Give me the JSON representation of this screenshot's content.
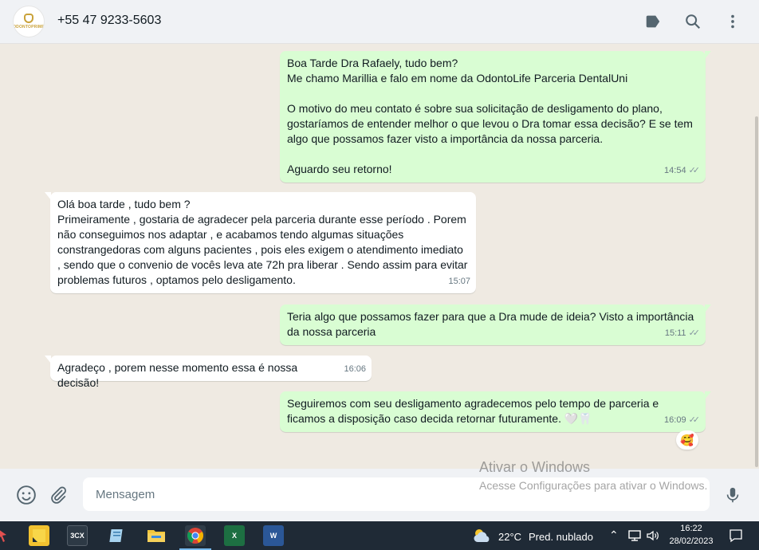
{
  "header": {
    "contact": "+55 47 9233-5603",
    "avatar_brand": "ODONTOPRIME",
    "icons": [
      "label-icon",
      "search-icon",
      "more-vert-icon"
    ]
  },
  "messages": [
    {
      "dir": "out",
      "text": "Boa Tarde Dra Rafaely, tudo bem?\nMe chamo Marillia e falo em nome da OdontoLife Parceria DentalUni\n\nO motivo do meu contato é sobre sua solicitação de desligamento do plano, gostaríamos de entender melhor o que levou o Dra tomar essa decisão? E se tem algo que possamos fazer visto a importância da nossa parceria.\n\nAguardo seu retorno!",
      "time": "14:54",
      "status": "read"
    },
    {
      "dir": "in",
      "text": "Olá boa tarde , tudo bem ?\nPrimeiramente , gostaria de agradecer pela parceria durante esse período . Porem não conseguimos nos adaptar , e acabamos tendo algumas situações constrangedoras com alguns pacientes , pois eles exigem o atendimento imediato , sendo que o convenio de vocês leva ate 72h pra liberar . Sendo assim para evitar problemas futuros , optamos pelo desligamento.",
      "time": "15:07"
    },
    {
      "dir": "out",
      "text": "Teria algo que possamos fazer para que a Dra mude de ideia? Visto a importância da nossa parceria",
      "time": "15:11",
      "status": "read"
    },
    {
      "dir": "in",
      "text": "Agradeço , porem nesse momento essa é nossa decisão!",
      "time": "16:06"
    },
    {
      "dir": "out",
      "text": "Seguiremos com seu desligamento agradecemos pelo tempo de parceria e ficamos a disposição caso decida retornar futuramente. 🤍🦷",
      "time": "16:09",
      "status": "read",
      "reaction": "🥰"
    }
  ],
  "composer": {
    "placeholder": "Mensagem",
    "icons": [
      "emoji-icon",
      "attach-icon",
      "mic-icon"
    ]
  },
  "watermark": {
    "title": "Ativar o Windows",
    "subtitle": "Acesse Configurações para ativar o Windows."
  },
  "taskbar": {
    "apps": [
      "3CX",
      "Chrome",
      "Excel",
      "Word"
    ],
    "app_labels": {
      "threecx": "3CX",
      "excel": "X",
      "word": "W"
    },
    "weather_temp": "22°C",
    "weather_desc": "Pred. nublado",
    "time": "16:22",
    "date": "28/02/2023"
  }
}
